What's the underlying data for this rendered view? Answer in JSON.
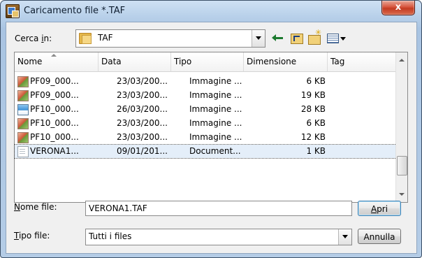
{
  "window": {
    "title": "Caricamento file *.TAF",
    "close_label": "x"
  },
  "lookin": {
    "label_prefix": "Cerca ",
    "label_underlined": "i",
    "label_suffix": "n:",
    "value": "TAF"
  },
  "list": {
    "columns": [
      "Nome",
      "Data",
      "Tipo",
      "Dimensione",
      "Tag"
    ],
    "rows": [
      {
        "icon": "image-file-icon",
        "name": "PF09_000...",
        "date": "23/03/200...",
        "type": "Immagine ...",
        "size": "6 KB",
        "selected": false
      },
      {
        "icon": "image-file-icon",
        "name": "PF09_000...",
        "date": "23/03/200...",
        "type": "Immagine ...",
        "size": "19 KB",
        "selected": false
      },
      {
        "icon": "image-file-blue-icon",
        "name": "PF10_000...",
        "date": "26/03/200...",
        "type": "Immagine ...",
        "size": "28 KB",
        "selected": false
      },
      {
        "icon": "image-file-icon",
        "name": "PF10_000...",
        "date": "23/03/200...",
        "type": "Immagine ...",
        "size": "6 KB",
        "selected": false
      },
      {
        "icon": "image-file-icon",
        "name": "PF10_000...",
        "date": "23/03/200...",
        "type": "Immagine ...",
        "size": "12 KB",
        "selected": false
      },
      {
        "icon": "document-file-icon",
        "name": "VERONA1...",
        "date": "09/01/201...",
        "type": "Document...",
        "size": "1 KB",
        "selected": true
      }
    ]
  },
  "filename": {
    "label_underlined": "N",
    "label_rest": "ome file:",
    "value": "VERONA1.TAF"
  },
  "filetype": {
    "label_underlined": "T",
    "label_rest": "ipo file:",
    "value": "Tutti i files"
  },
  "buttons": {
    "open_underlined": "A",
    "open_rest": "pri",
    "cancel": "Annulla"
  },
  "colors": {
    "title_bar": "#b9d1ea",
    "close_button": "#c33b22",
    "selection": "#e4eef9"
  }
}
